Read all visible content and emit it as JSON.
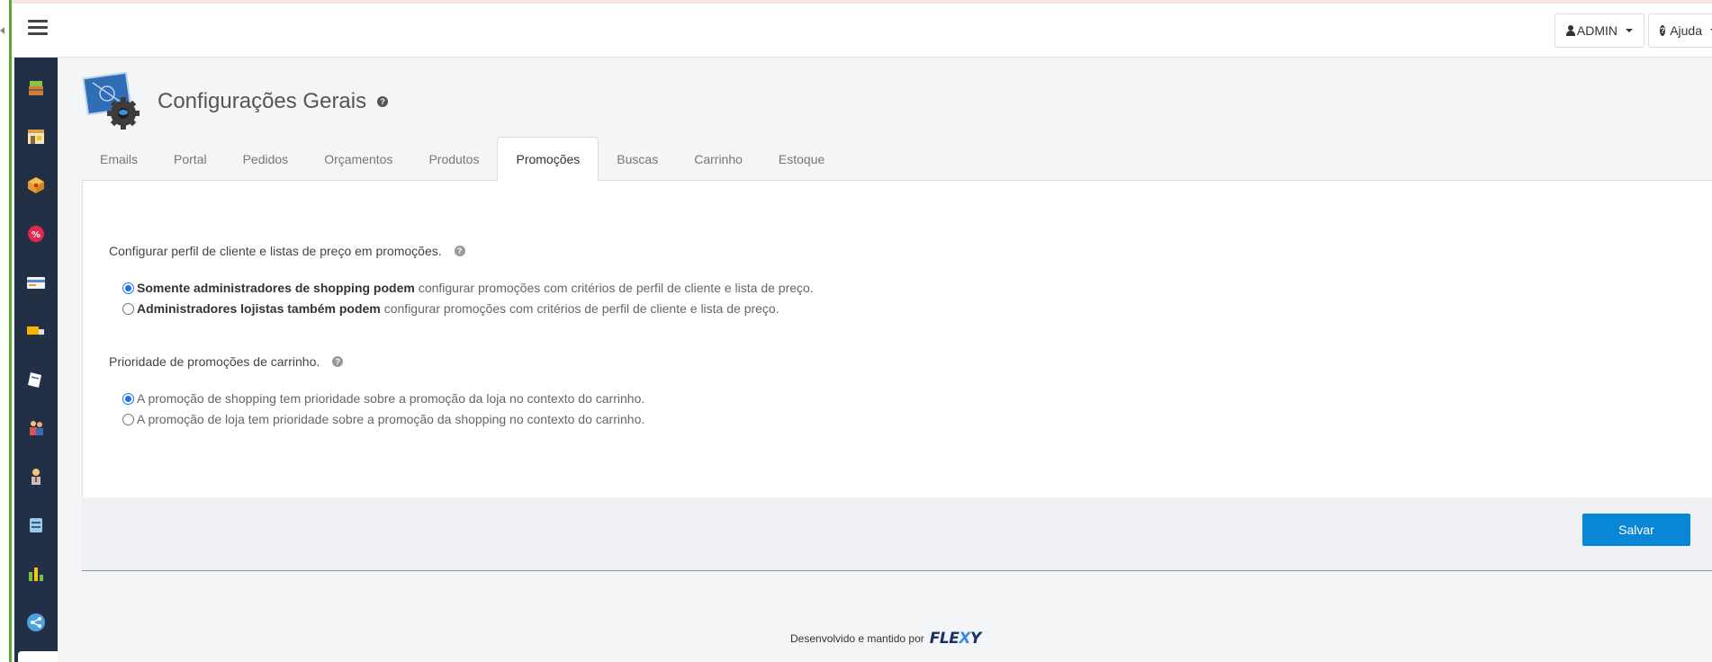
{
  "topbar": {
    "admin_label": "ADMIN",
    "help_label": "Ajuda"
  },
  "sidebar": {
    "items": [
      {
        "icon": "box-stack-icon",
        "color": "#8bc34a"
      },
      {
        "icon": "store-icon",
        "color": "#e8c46a"
      },
      {
        "icon": "package-icon",
        "color": "#f2a93b"
      },
      {
        "icon": "discount-icon",
        "color": "#e2264d"
      },
      {
        "icon": "credit-card-icon",
        "color": "#f4f4f4"
      },
      {
        "icon": "truck-icon",
        "color": "#f5b400"
      },
      {
        "icon": "note-icon",
        "color": "#ffffff"
      },
      {
        "icon": "users-icon",
        "color": "#d9534f"
      },
      {
        "icon": "person-icon",
        "color": "#c0c0c0"
      },
      {
        "icon": "database-icon",
        "color": "#9ecbe8"
      },
      {
        "icon": "bar-chart-icon",
        "color": "#7cc243"
      },
      {
        "icon": "share-icon",
        "color": "#4aa3df"
      }
    ]
  },
  "header": {
    "title": "Configurações Gerais"
  },
  "tabs": [
    {
      "label": "Emails",
      "active": false
    },
    {
      "label": "Portal",
      "active": false
    },
    {
      "label": "Pedidos",
      "active": false
    },
    {
      "label": "Orçamentos",
      "active": false
    },
    {
      "label": "Produtos",
      "active": false
    },
    {
      "label": "Promoções",
      "active": true
    },
    {
      "label": "Buscas",
      "active": false
    },
    {
      "label": "Carrinho",
      "active": false
    },
    {
      "label": "Estoque",
      "active": false
    }
  ],
  "settings": {
    "profile": {
      "label": "Configurar perfil de cliente e listas de preço em promoções.",
      "options": [
        {
          "bold": "Somente administradores de shopping podem",
          "text": "configurar promoções com critérios de perfil de cliente e lista de preço.",
          "checked": true
        },
        {
          "bold": "Administradores lojistas também podem",
          "text": "configurar promoções com critérios de perfil de cliente e lista de preço.",
          "checked": false
        }
      ]
    },
    "priority": {
      "label": "Prioridade de promoções de carrinho.",
      "options": [
        {
          "text": "A promoção de shopping tem prioridade sobre a promoção da loja no contexto do carrinho.",
          "checked": true
        },
        {
          "text": "A promoção de loja tem prioridade sobre a promoção da shopping no contexto do carrinho.",
          "checked": false
        }
      ]
    }
  },
  "actions": {
    "save_label": "Salvar"
  },
  "footer": {
    "credit": "Desenvolvido e mantido por",
    "brand": "FLEXY"
  },
  "colors": {
    "accent": "#0a86d6",
    "sidebar_bg": "#232f44",
    "green_stripe": "#5aa832"
  }
}
